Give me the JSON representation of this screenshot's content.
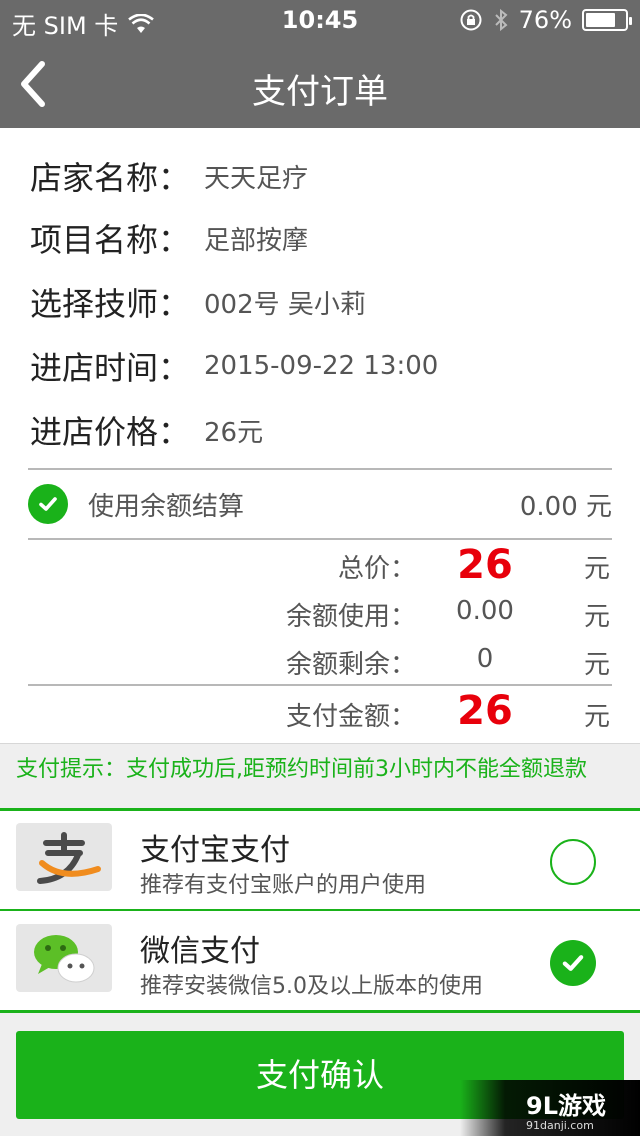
{
  "status_bar": {
    "carrier": "无 SIM 卡",
    "time": "10:45",
    "battery_text": "76%",
    "battery_level": 0.76
  },
  "nav": {
    "title": "支付订单",
    "back_icon": "chevron-left-icon"
  },
  "order": {
    "rows": [
      {
        "label": "店家名称：",
        "value": "天天足疗"
      },
      {
        "label": "项目名称：",
        "value": "足部按摩"
      },
      {
        "label": "选择技师：",
        "value": "002号 吴小莉"
      },
      {
        "label": "进店时间：",
        "value": "2015-09-22 13:00"
      },
      {
        "label": "进店价格：",
        "value": "26元"
      }
    ]
  },
  "balance": {
    "label": "使用余额结算",
    "amount": "0.00 元",
    "checked": true
  },
  "summary": {
    "total_label": "总价：",
    "total_value": "26",
    "used_label": "余额使用：",
    "used_value": "0.00",
    "remain_label": "余额剩余：",
    "remain_value": "0",
    "pay_label": "支付金额：",
    "pay_value": "26",
    "unit": "元"
  },
  "tip": {
    "text": "支付提示：支付成功后,距预约时间前3小时内不能全额退款"
  },
  "payment_methods": [
    {
      "title": "支付宝支付",
      "subtitle": "推荐有支付宝账户的用户使用",
      "icon": "alipay-icon",
      "selected": false
    },
    {
      "title": "微信支付",
      "subtitle": "推荐安装微信5.0及以上版本的使用",
      "icon": "wechat-icon",
      "selected": true
    }
  ],
  "confirm_label": "支付确认",
  "watermark": {
    "brand": "9L游戏",
    "site": "91danji.com"
  },
  "colors": {
    "header": "#6a6a6a",
    "accent_green": "#1ab21a",
    "price_red": "#e8000b"
  }
}
